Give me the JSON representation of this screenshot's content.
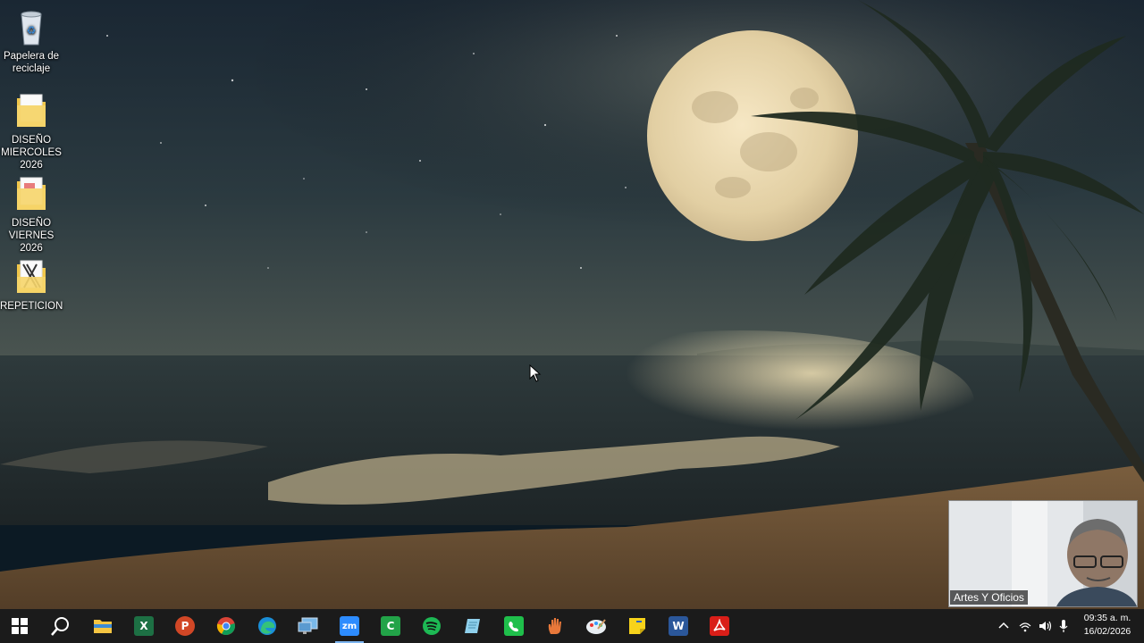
{
  "desktop": {
    "icons": [
      {
        "label": "Papelera de reciclaje",
        "icon": "recycle-bin-icon"
      },
      {
        "label": "DISEÑO MIERCOLES 2026",
        "icon": "folder-icon"
      },
      {
        "label": "DISEÑO VIERNES 2026",
        "icon": "folder-icon"
      },
      {
        "label": "REPETICION",
        "icon": "folder-icon"
      }
    ]
  },
  "taskbar": {
    "apps": [
      {
        "name": "start",
        "icon": "windows-start-icon"
      },
      {
        "name": "search",
        "icon": "search-icon"
      },
      {
        "name": "file-explorer",
        "icon": "folder-icon"
      },
      {
        "name": "excel",
        "icon": "excel-icon",
        "letter": "X",
        "color": "#1d7044"
      },
      {
        "name": "powerpoint",
        "icon": "powerpoint-icon",
        "letter": "P",
        "color": "#d24726"
      },
      {
        "name": "chrome",
        "icon": "chrome-icon"
      },
      {
        "name": "edge",
        "icon": "edge-icon"
      },
      {
        "name": "remote-desktop",
        "icon": "monitor-icon"
      },
      {
        "name": "zoom",
        "icon": "zoom-icon",
        "letter": "zm",
        "color": "#2d8cff"
      },
      {
        "name": "camtasia",
        "icon": "camtasia-icon",
        "letter": "C",
        "color": "#22a348"
      },
      {
        "name": "spotify",
        "icon": "spotify-icon",
        "color": "#1db954"
      },
      {
        "name": "notepad",
        "icon": "notepad-icon"
      },
      {
        "name": "phone-app",
        "icon": "phone-icon",
        "color": "#1fbf4b"
      },
      {
        "name": "hand-app",
        "icon": "hand-icon"
      },
      {
        "name": "paint",
        "icon": "palette-icon"
      },
      {
        "name": "sticky-notes",
        "icon": "sticky-note-icon",
        "color": "#f7d31b"
      },
      {
        "name": "word",
        "icon": "word-icon",
        "letter": "W",
        "color": "#2b579a"
      },
      {
        "name": "acrobat",
        "icon": "pdf-icon",
        "color": "#d91e18"
      }
    ],
    "clock": {
      "time": "09:35 a. m.",
      "date": "16/02/2026"
    }
  },
  "webcam": {
    "label": "Artes Y Oficios"
  },
  "colors": {
    "taskbar": "#1b1b1b",
    "active_indicator": "#7cb4f0"
  }
}
